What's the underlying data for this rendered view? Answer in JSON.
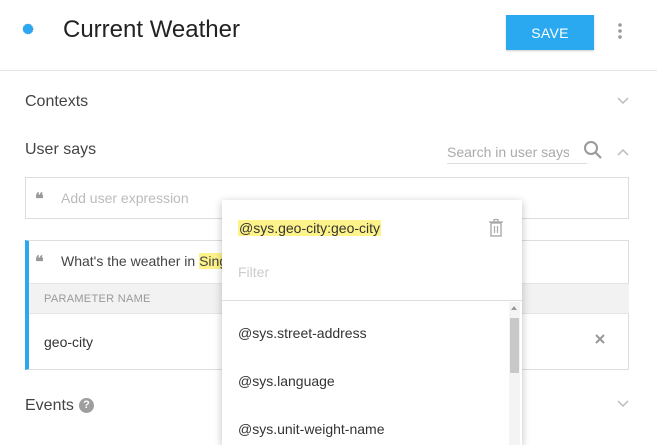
{
  "header": {
    "title": "Current Weather",
    "save_label": "SAVE"
  },
  "sections": {
    "contexts": "Contexts",
    "user_says": "User says",
    "events": "Events"
  },
  "search": {
    "placeholder": "Search in user says"
  },
  "add_expression": {
    "placeholder": "Add user expression"
  },
  "expression": {
    "text_before": "What's the weather in ",
    "highlight": "Sing"
  },
  "parameters": {
    "header": "PARAMETER NAME",
    "rows": [
      {
        "name": "geo-city"
      }
    ]
  },
  "help_glyph": "?",
  "dropdown": {
    "selected": "@sys.geo-city:geo-city",
    "filter_placeholder": "Filter",
    "items": [
      "@sys.street-address",
      "@sys.language",
      "@sys.unit-weight-name"
    ]
  },
  "colors": {
    "accent": "#2aa9f1",
    "highlight": "#fdf38a"
  },
  "icons": {
    "logo": "dot-icon",
    "more": "more-vert-icon",
    "search": "search-icon",
    "chevron": "chevron-icon",
    "quote": "quote-icon",
    "close": "close-icon",
    "help": "help-icon",
    "trash": "trash-icon"
  }
}
